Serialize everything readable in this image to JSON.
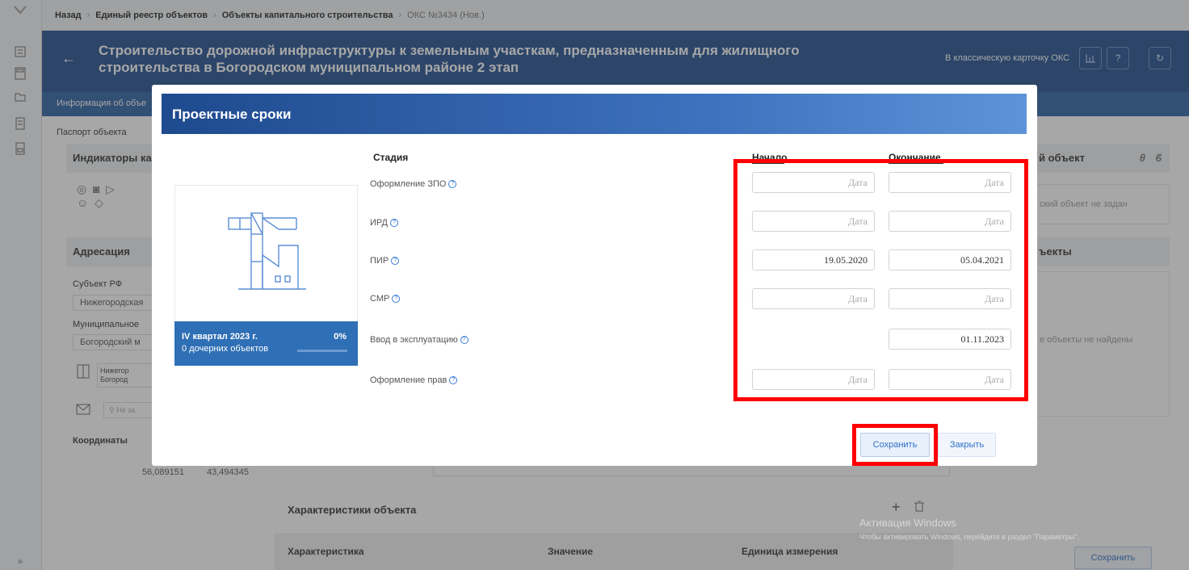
{
  "breadcrumb": {
    "items": [
      "Назад",
      "Единый реестр объектов",
      "Объекты капитального строительства",
      "ОКС №3434 (Нов.)"
    ]
  },
  "header": {
    "title": "Строительство дорожной инфраструктуры к земельным участкам, предназначенным для жилищного строительства в Богородском муниципальном районе 2 этап",
    "classic_link": "В классическую карточку ОКС"
  },
  "subtabs": {
    "info_label": "Информация об объе"
  },
  "background": {
    "tabs": [
      "Паспорт объекта"
    ],
    "indicators_title": "Индикаторы ка",
    "addressing_title": "Адресация",
    "subject_label": "Субъект РФ",
    "subject_value": "Нижегородская",
    "municipal_label": "Муниципальное",
    "municipal_value": "Богородский м",
    "address_line1": "Нижегор",
    "address_line2": "Богород",
    "search_placeholder": "Не за",
    "coords_label": "Координаты",
    "coord_lat": "56,089151",
    "coord_lon": "43,494345",
    "right_object_title": "й объект",
    "right_object_empty": "ский объект не задан",
    "right_objects_title": "ъекты",
    "right_objects_empty": "е объекты не найдены",
    "characteristics_title": "Характеристики объекта",
    "table_headers": [
      "Характеристика",
      "Значение",
      "Единица измерения"
    ],
    "bottom_save": "Сохранить"
  },
  "watermark": {
    "line1": "Активация Windows",
    "line2": "Чтобы активировать Windows, перейдите в раздел \"Параметры\"."
  },
  "modal": {
    "title": "Проектные сроки",
    "preview": {
      "quarter": "IV квартал 2023 г.",
      "percent": "0%",
      "progress": 0,
      "children": "0 дочерних объектов"
    },
    "columns": {
      "stage": "Стадия",
      "start": "Начало",
      "end": "Окончание"
    },
    "placeholder": "Дата",
    "stages": [
      {
        "label": "Оформление ЗПО",
        "start": "",
        "end": ""
      },
      {
        "label": "ИРД",
        "start": "",
        "end": ""
      },
      {
        "label": "ПИР",
        "start": "19.05.2020",
        "end": "05.04.2021"
      },
      {
        "label": "СМР",
        "start": "",
        "end": ""
      },
      {
        "label": "Ввод в эксплуатацию",
        "end": "01.11.2023"
      },
      {
        "label": "Оформление прав",
        "start": "",
        "end": ""
      }
    ],
    "save_label": "Сохранить",
    "close_label": "Закрыть"
  },
  "colors": {
    "header_blue": "#1f4e8f",
    "highlight": "#ff0000",
    "accent": "#2f6fc7"
  }
}
